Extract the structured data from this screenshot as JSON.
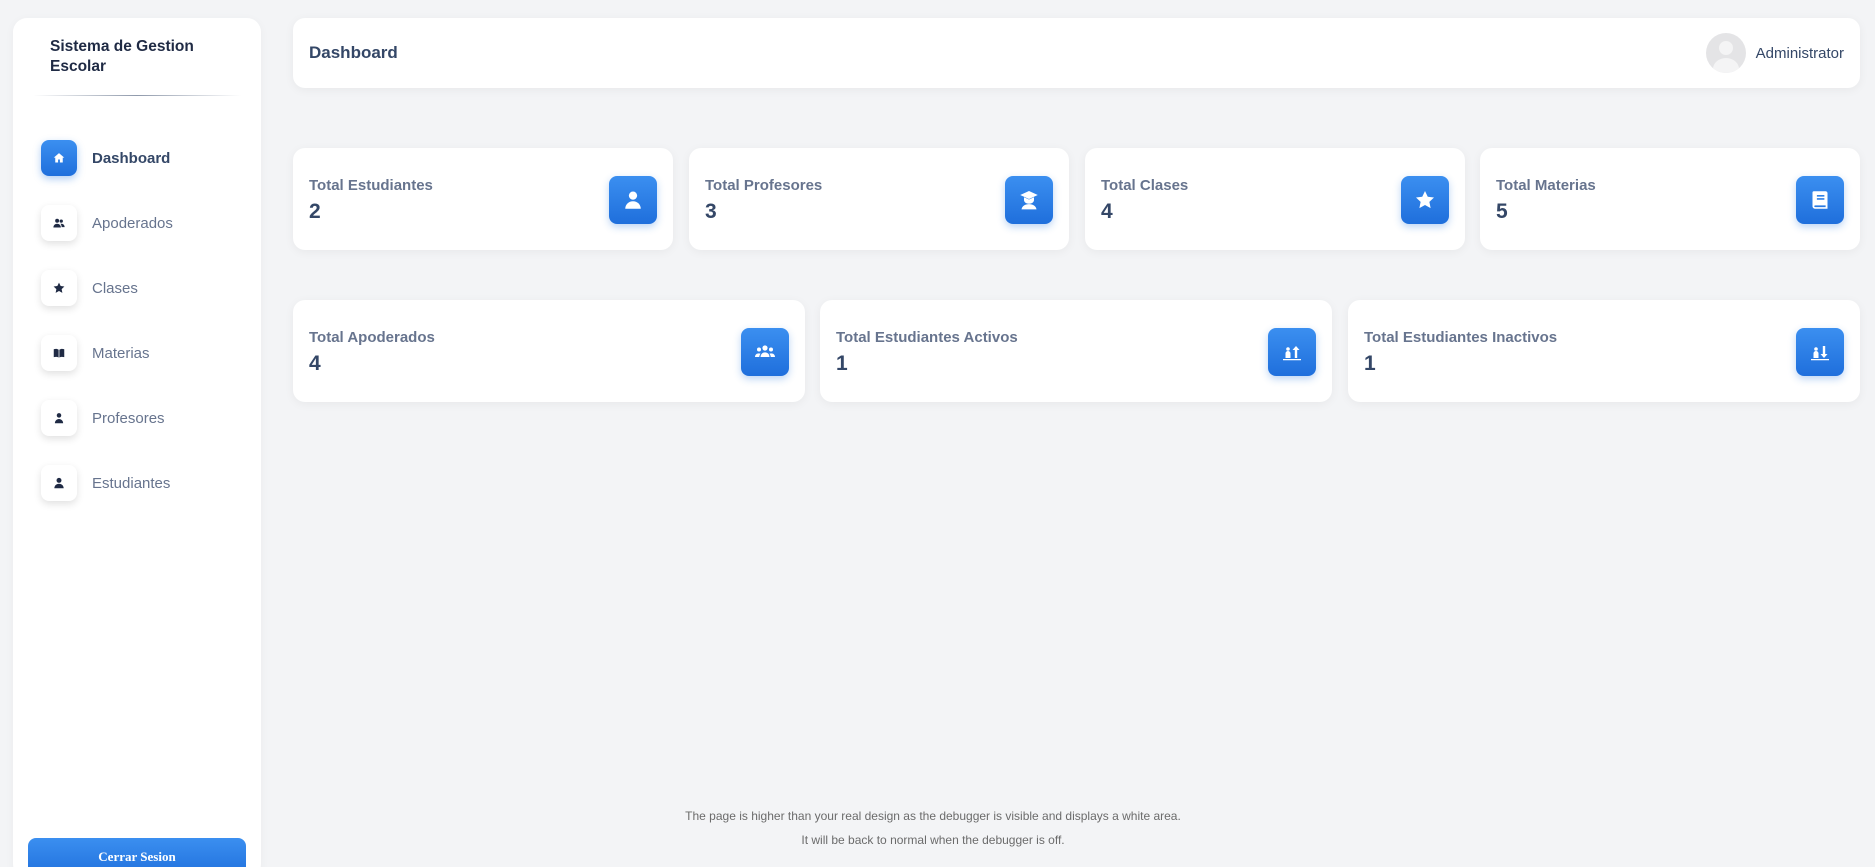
{
  "sidebar": {
    "brand": "Sistema de Gestion Escolar",
    "items": [
      {
        "label": "Dashboard",
        "icon": "home-icon",
        "active": true
      },
      {
        "label": "Apoderados",
        "icon": "users-icon",
        "active": false
      },
      {
        "label": "Clases",
        "icon": "star-icon",
        "active": false
      },
      {
        "label": "Materias",
        "icon": "book-open-icon",
        "active": false
      },
      {
        "label": "Profesores",
        "icon": "teacher-icon",
        "active": false
      },
      {
        "label": "Estudiantes",
        "icon": "user-icon",
        "active": false
      }
    ],
    "logout_label": "Cerrar Sesion"
  },
  "header": {
    "title": "Dashboard",
    "user_name": "Administrator"
  },
  "stats_row1": [
    {
      "title": "Total Estudiantes",
      "value": "2",
      "icon": "user-icon"
    },
    {
      "title": "Total Profesores",
      "value": "3",
      "icon": "graduation-icon"
    },
    {
      "title": "Total Clases",
      "value": "4",
      "icon": "star-icon"
    },
    {
      "title": "Total Materias",
      "value": "5",
      "icon": "book-icon"
    }
  ],
  "stats_row2": [
    {
      "title": "Total Apoderados",
      "value": "4",
      "icon": "group-icon"
    },
    {
      "title": "Total Estudiantes Activos",
      "value": "1",
      "icon": "arrow-up-icon"
    },
    {
      "title": "Total Estudiantes Inactivos",
      "value": "1",
      "icon": "arrow-down-icon"
    }
  ],
  "debug": {
    "line1": "The page is higher than your real design as the debugger is visible and displays a white area.",
    "line2": "It will be back to normal when the debugger is off."
  },
  "colors": {
    "accent": "#1f6fdc",
    "background": "#f3f4f6",
    "text_dark": "#344767",
    "text_muted": "#67748e"
  }
}
